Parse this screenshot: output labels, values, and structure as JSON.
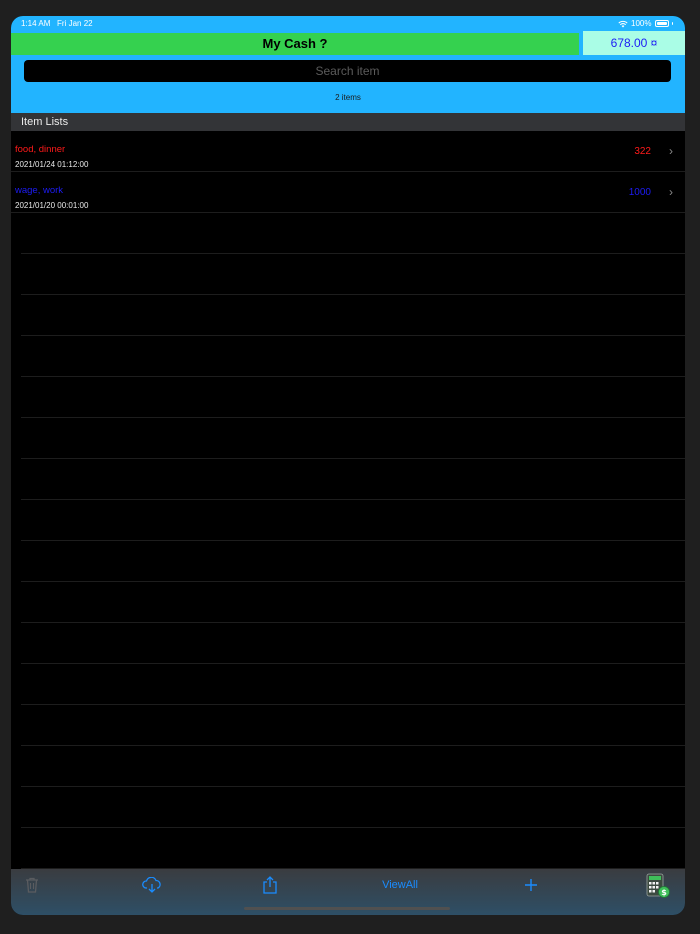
{
  "status": {
    "time": "1:14 AM",
    "date": "Fri Jan 22",
    "battery": "100%"
  },
  "header": {
    "title": "My Cash ?",
    "balance": "678.00 ¤"
  },
  "search": {
    "placeholder": "Search item"
  },
  "summary": {
    "count": "2 items"
  },
  "section": {
    "title": "Item Lists"
  },
  "items": [
    {
      "title": "food, dinner",
      "date": "2021/01/24 01:12:00",
      "amount": "322",
      "color": "#ff1a1a"
    },
    {
      "title": "wage, work",
      "date": "2021/01/20 00:01:00",
      "amount": "1000",
      "color": "#1d1cf5"
    }
  ],
  "toolbar": {
    "trash_icon": "trash-icon",
    "cloud_icon": "cloud-download-icon",
    "share_icon": "share-icon",
    "viewall_label": "ViewAll",
    "add_icon": "plus-icon",
    "calc_icon": "calculator-icon"
  },
  "colors": {
    "header_bg": "#22b4ff",
    "title_bg": "#35d14f",
    "balance_bg": "#aafde6",
    "expense": "#ff1a1a",
    "income": "#1d1cf5",
    "accent": "#1a8cff"
  }
}
